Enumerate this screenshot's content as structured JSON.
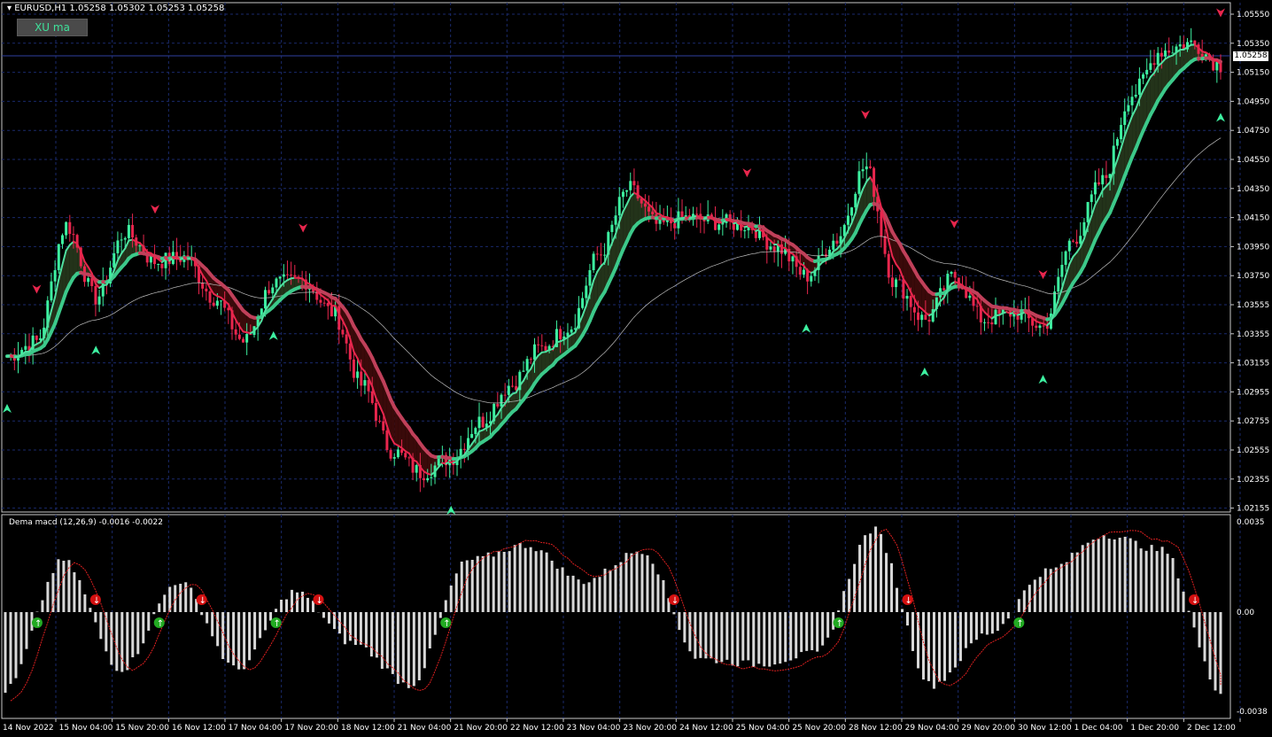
{
  "main_pane": {
    "header": "EURUSD,H1  1.05258 1.05302 1.05253 1.05258",
    "button_label": "XU ma",
    "current_price": "1.05258",
    "price_ticks": [
      "1.05550",
      "1.05350",
      "1.05150",
      "1.04950",
      "1.04750",
      "1.04550",
      "1.04350",
      "1.04150",
      "1.03950",
      "1.03750",
      "1.03555",
      "1.03355",
      "1.03155",
      "1.02955",
      "1.02755",
      "1.02555",
      "1.02355",
      "1.02155"
    ],
    "price_range": [
      1.021,
      1.056
    ]
  },
  "sub_pane": {
    "header": "Dema macd (12,26,9) -0.0016 -0.0022",
    "value_ticks": [
      "0.0035",
      "0.00",
      "-0.0038"
    ],
    "value_range": [
      -0.0038,
      0.0035
    ]
  },
  "time_axis": {
    "labels": [
      "14 Nov 2022",
      "15 Nov 04:00",
      "15 Nov 20:00",
      "16 Nov 12:00",
      "17 Nov 04:00",
      "17 Nov 20:00",
      "18 Nov 12:00",
      "21 Nov 04:00",
      "21 Nov 20:00",
      "22 Nov 12:00",
      "23 Nov 04:00",
      "23 Nov 20:00",
      "24 Nov 12:00",
      "25 Nov 04:00",
      "25 Nov 20:00",
      "28 Nov 12:00",
      "29 Nov 04:00",
      "29 Nov 20:00",
      "30 Nov 12:00",
      "1 Dec 04:00",
      "1 Dec 20:00",
      "2 Dec 12:00"
    ]
  },
  "colors": {
    "background": "#000000",
    "grid": "#1a2a6c",
    "bull": "#3df0a0",
    "bear": "#e8264d",
    "fast_ma": "#4fe0a0",
    "slow_ma_up": "#3cc98a",
    "slow_ma_down": "#c0405a",
    "fill_up": "#23331a",
    "fill_down": "#3a0a0a",
    "histogram": "#d8d8d8",
    "signal": "#e02020"
  },
  "chart_data": {
    "type": "candlestick",
    "symbol": "EURUSD",
    "timeframe": "H1",
    "ohlc_last": {
      "open": 1.05258,
      "high": 1.05302,
      "low": 1.05253,
      "close": 1.05258
    },
    "price_path": [
      [
        "14 Nov 2022",
        1.032
      ],
      [
        "15 Nov 04:00",
        1.033
      ],
      [
        "15 Nov 12:00",
        1.041
      ],
      [
        "15 Nov 20:00",
        1.036
      ],
      [
        "16 Nov 04:00",
        1.0405
      ],
      [
        "16 Nov 12:00",
        1.0385
      ],
      [
        "16 Nov 20:00",
        1.0388
      ],
      [
        "17 Nov 04:00",
        1.036
      ],
      [
        "17 Nov 12:00",
        1.033
      ],
      [
        "17 Nov 20:00",
        1.037
      ],
      [
        "18 Nov 04:00",
        1.0372
      ],
      [
        "18 Nov 12:00",
        1.035
      ],
      [
        "18 Nov 20:00",
        1.03
      ],
      [
        "21 Nov 04:00",
        1.0255
      ],
      [
        "21 Nov 12:00",
        1.024
      ],
      [
        "21 Nov 20:00",
        1.025
      ],
      [
        "22 Nov 04:00",
        1.0275
      ],
      [
        "22 Nov 12:00",
        1.03
      ],
      [
        "22 Nov 20:00",
        1.0325
      ],
      [
        "23 Nov 04:00",
        1.034
      ],
      [
        "23 Nov 12:00",
        1.039
      ],
      [
        "23 Nov 20:00",
        1.0435
      ],
      [
        "24 Nov 04:00",
        1.041
      ],
      [
        "24 Nov 12:00",
        1.0415
      ],
      [
        "24 Nov 20:00",
        1.0412
      ],
      [
        "25 Nov 04:00",
        1.041
      ],
      [
        "25 Nov 12:00",
        1.0395
      ],
      [
        "25 Nov 20:00",
        1.0375
      ],
      [
        "28 Nov 04:00",
        1.04
      ],
      [
        "28 Nov 12:00",
        1.045
      ],
      [
        "28 Nov 20:00",
        1.037
      ],
      [
        "29 Nov 04:00",
        1.0345
      ],
      [
        "29 Nov 12:00",
        1.0375
      ],
      [
        "29 Nov 20:00",
        1.0345
      ],
      [
        "30 Nov 04:00",
        1.035
      ],
      [
        "30 Nov 12:00",
        1.034
      ],
      [
        "30 Nov 20:00",
        1.04
      ],
      [
        "1 Dec 04:00",
        1.044
      ],
      [
        "1 Dec 12:00",
        1.05
      ],
      [
        "1 Dec 20:00",
        1.053
      ],
      [
        "2 Dec 04:00",
        1.0535
      ],
      [
        "2 Dec 12:00",
        1.052
      ]
    ],
    "macd_hist_path": [
      [
        "14 Nov 2022",
        -0.003
      ],
      [
        "15 Nov 04:00",
        0.002
      ],
      [
        "15 Nov 20:00",
        -0.0022
      ],
      [
        "16 Nov 12:00",
        0.0012
      ],
      [
        "17 Nov 04:00",
        -0.0022
      ],
      [
        "17 Nov 20:00",
        0.0008
      ],
      [
        "18 Nov 12:00",
        -0.0012
      ],
      [
        "21 Nov 04:00",
        -0.0028
      ],
      [
        "21 Nov 20:00",
        0.002
      ],
      [
        "22 Nov 12:00",
        0.0026
      ],
      [
        "23 Nov 04:00",
        0.0012
      ],
      [
        "23 Nov 20:00",
        0.0024
      ],
      [
        "24 Nov 12:00",
        -0.0018
      ],
      [
        "25 Nov 04:00",
        -0.002
      ],
      [
        "25 Nov 20:00",
        -0.0016
      ],
      [
        "28 Nov 12:00",
        0.0032
      ],
      [
        "29 Nov 04:00",
        -0.0028
      ],
      [
        "29 Nov 20:00",
        -0.0008
      ],
      [
        "30 Nov 12:00",
        0.0016
      ],
      [
        "1 Dec 04:00",
        0.003
      ],
      [
        "1 Dec 20:00",
        0.0024
      ],
      [
        "2 Dec 12:00",
        -0.003
      ]
    ],
    "buy_arrows": [
      "14 Nov 2022",
      "15 Nov 20:00",
      "17 Nov 20:00",
      "21 Nov 20:00",
      "25 Nov 20:00",
      "29 Nov 04:00",
      "30 Nov 12:00",
      "2 Dec 12:00"
    ],
    "sell_arrows": [
      "15 Nov 04:00",
      "16 Nov 12:00",
      "18 Nov 04:00",
      "25 Nov 04:00",
      "28 Nov 12:00",
      "29 Nov 12:00",
      "30 Nov 12:00",
      "2 Dec 12:00"
    ]
  }
}
